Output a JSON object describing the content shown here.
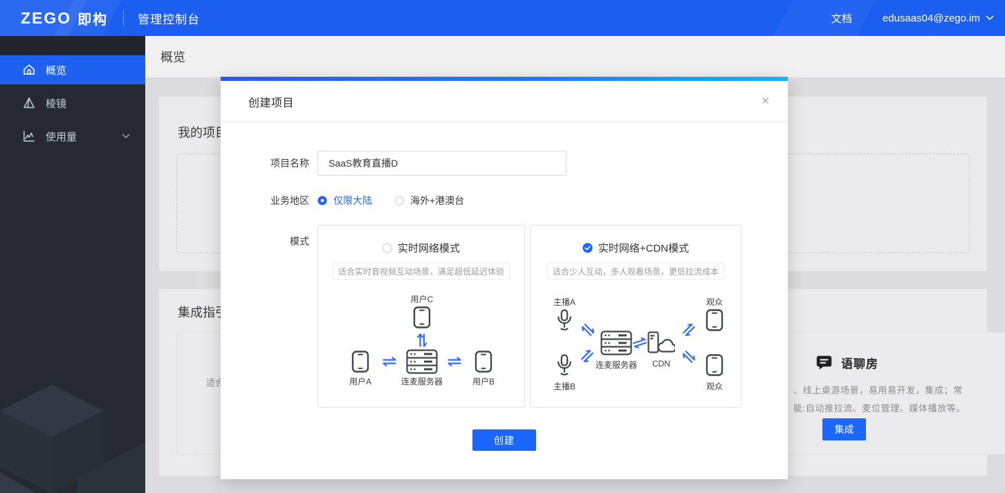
{
  "topbar": {
    "logo_text": "ZEGO",
    "logo_cn": "即构",
    "console_title": "管理控制台",
    "docs": "文档",
    "account": "edusaas04@zego.im"
  },
  "sidebar": {
    "items": [
      {
        "label": "概览"
      },
      {
        "label": "棱镜"
      },
      {
        "label": "使用量"
      }
    ]
  },
  "page": {
    "heading": "概览",
    "my_projects": {
      "title": "我的项目"
    },
    "integration": {
      "title": "集成指引",
      "left_card_fragment": "适合",
      "voice_room": {
        "title": "语聊房",
        "desc_line1": "、线上桌游场景，易用易开发，集成；常",
        "desc_line2": "能:自动推拉流、麦位管理、媒体播放等。",
        "integrate_button": "集成"
      }
    }
  },
  "modal": {
    "title": "创建项目",
    "close": "✕",
    "fields": {
      "name_label": "项目名称",
      "name_value": "SaaS教育直播D",
      "region_label": "业务地区",
      "region_options": [
        {
          "label": "仅限大陆",
          "selected": true
        },
        {
          "label": "海外+港澳台",
          "selected": false
        }
      ],
      "mode_label": "模式"
    },
    "modes": [
      {
        "title": "实时网络模式",
        "selected": false,
        "desc": "适合实时音视频互动场景，满足超低延迟体验",
        "diagram": {
          "top_label": "用户C",
          "left_label": "用户A",
          "center_label": "连麦服务器",
          "right_label": "用户B"
        }
      },
      {
        "title": "实时网络+CDN模式",
        "selected": true,
        "desc": "适合少人互动，多人观看场景，更低拉流成本",
        "diagram": {
          "top_left_label": "主播A",
          "bottom_left_label": "主播B",
          "center_label": "连麦服务器",
          "cdn_label": "CDN",
          "top_right_label": "观众",
          "bottom_right_label": "观众"
        }
      }
    ],
    "create_button": "创建"
  },
  "colors": {
    "accent": "#1a66ff",
    "topbar_blue": "#1c5ef0",
    "sidebar_dark": "#262932",
    "gradient_start": "#2b57f0",
    "gradient_end": "#13b5ff",
    "arrow_blue": "#2e6bff"
  }
}
